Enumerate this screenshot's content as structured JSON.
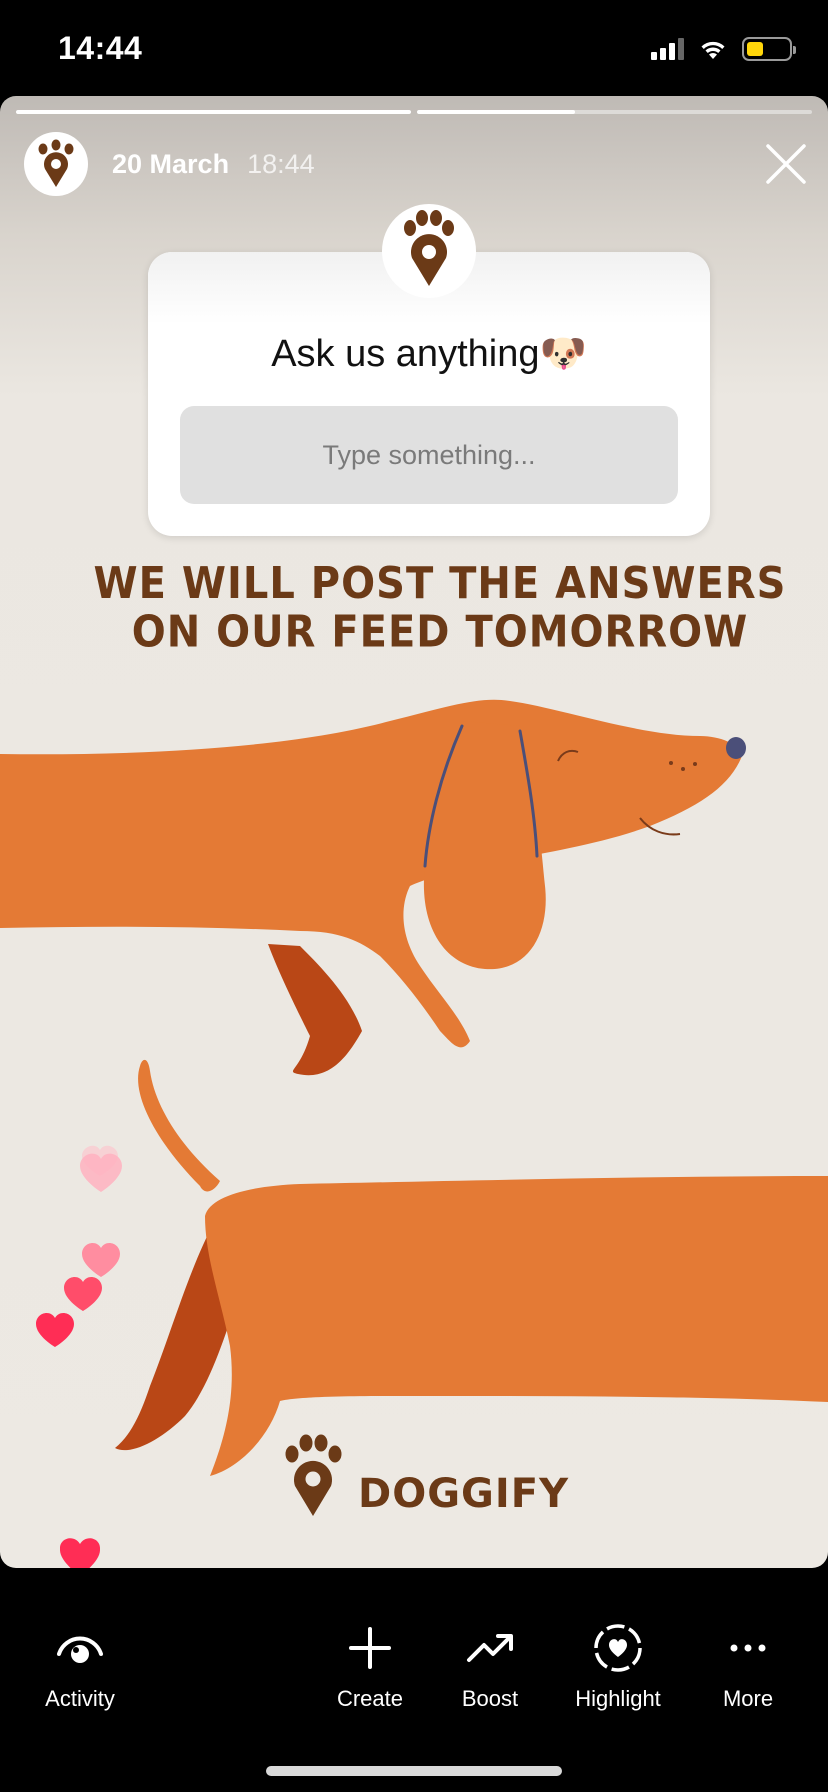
{
  "status_bar": {
    "time": "14:44"
  },
  "story": {
    "progress": [
      1.0,
      0.4
    ],
    "date": "20 March",
    "time": "18:44"
  },
  "sticker": {
    "title": "Ask us anything🐶",
    "placeholder": "Type something..."
  },
  "announcement": [
    "WE WILL POST THE ANSWERS",
    "ON OUR FEED TOMORROW"
  ],
  "brand": {
    "name": "DOGGIFY"
  },
  "colors": {
    "brand_brown": "#6b3a17",
    "dog_orange": "#e47a35",
    "heart_red": "#ff2d55",
    "battery_yellow": "#ffd60a"
  },
  "bottom_nav": [
    {
      "label": "Activity",
      "icon": "eye-icon"
    },
    {
      "label": "Create",
      "icon": "plus-icon"
    },
    {
      "label": "Boost",
      "icon": "trending-up-icon"
    },
    {
      "label": "Highlight",
      "icon": "heart-circle-icon"
    },
    {
      "label": "More",
      "icon": "more-dots-icon"
    }
  ]
}
